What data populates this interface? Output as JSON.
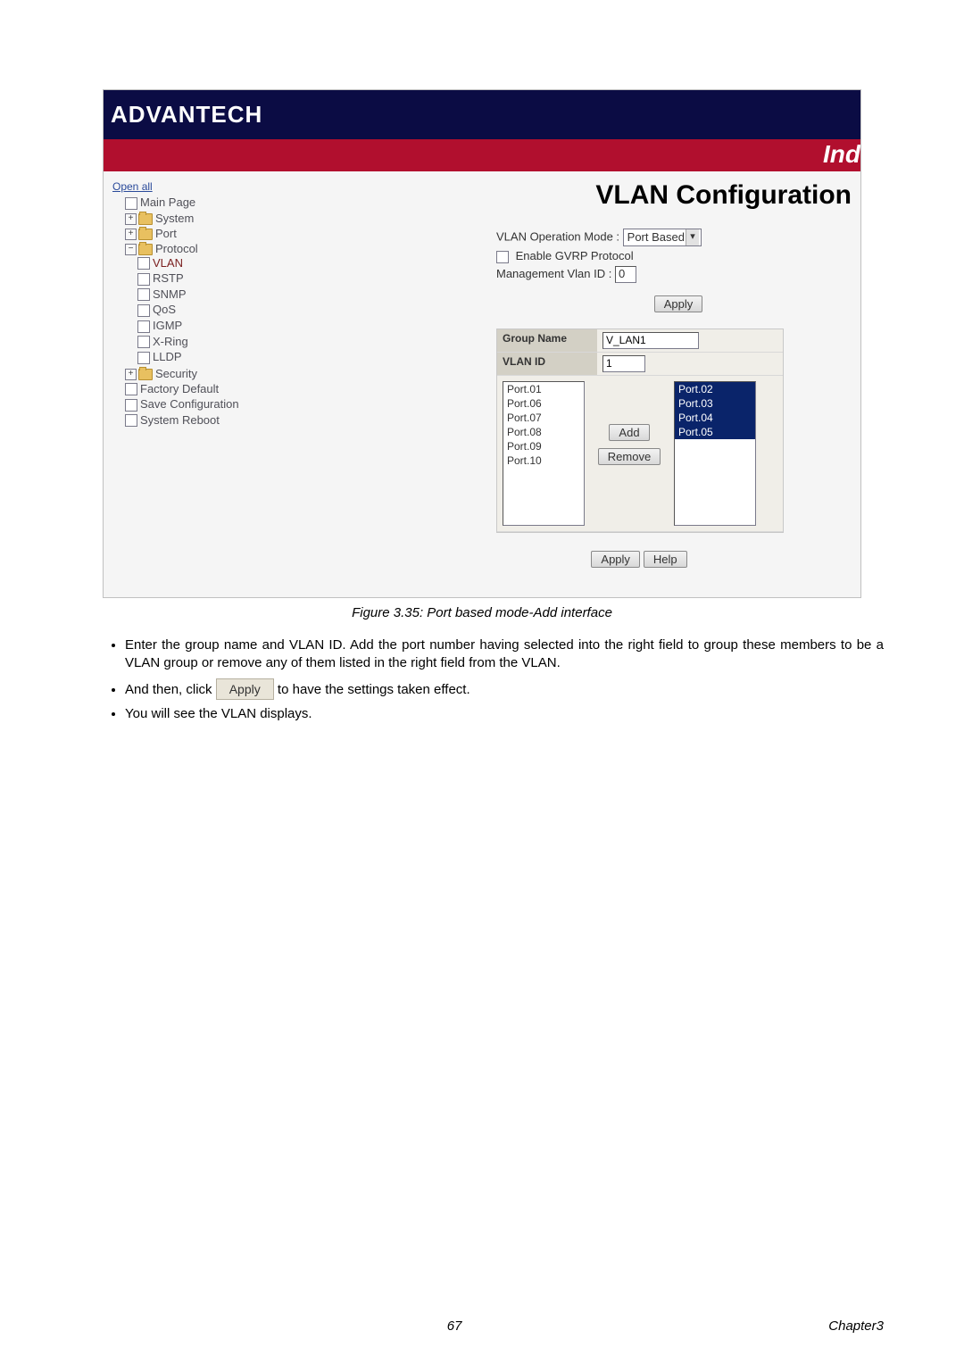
{
  "header": {
    "logo_text": "ADVANTECH",
    "right_text": "Ind"
  },
  "sidebar": {
    "open_all": "Open all",
    "items": {
      "main_page": "Main Page",
      "system": "System",
      "port": "Port",
      "protocol": "Protocol",
      "protocol_children": {
        "vlan": "VLAN",
        "rstp": "RSTP",
        "snmp": "SNMP",
        "qos": "QoS",
        "igmp": "IGMP",
        "xring": "X-Ring",
        "lldp": "LLDP"
      },
      "security": "Security",
      "factory_default": "Factory Default",
      "save_config": "Save Configuration",
      "system_reboot": "System Reboot"
    }
  },
  "content": {
    "title": "VLAN Configuration",
    "mode_label": "VLAN Operation Mode :",
    "mode_value": "Port Based",
    "gvrp_label": "Enable GVRP Protocol",
    "mgmt_label": "Management Vlan ID :",
    "mgmt_value": "0",
    "apply_btn": "Apply",
    "group_name_label": "Group Name",
    "group_name_value": "V_LAN1",
    "vlan_id_label": "VLAN ID",
    "vlan_id_value": "1",
    "left_ports": [
      "Port.01",
      "Port.06",
      "Port.07",
      "Port.08",
      "Port.09",
      "Port.10"
    ],
    "right_ports": [
      "Port.02",
      "Port.03",
      "Port.04",
      "Port.05"
    ],
    "add_btn": "Add",
    "remove_btn": "Remove",
    "apply2_btn": "Apply",
    "help_btn": "Help"
  },
  "figure_caption": "Figure 3.35: Port based mode-Add interface",
  "body_text": {
    "b1": "Enter the group name and VLAN ID. Add the port number having selected into the right field to group these members to be a VLAN group or remove any of them listed in the right field from the VLAN.",
    "b2a": "And then, click ",
    "b2_btn": "Apply",
    "b2b": " to have the settings taken effect.",
    "b3": "You will see the VLAN displays."
  },
  "footer": {
    "page": "67",
    "chapter": "Chapter3"
  }
}
